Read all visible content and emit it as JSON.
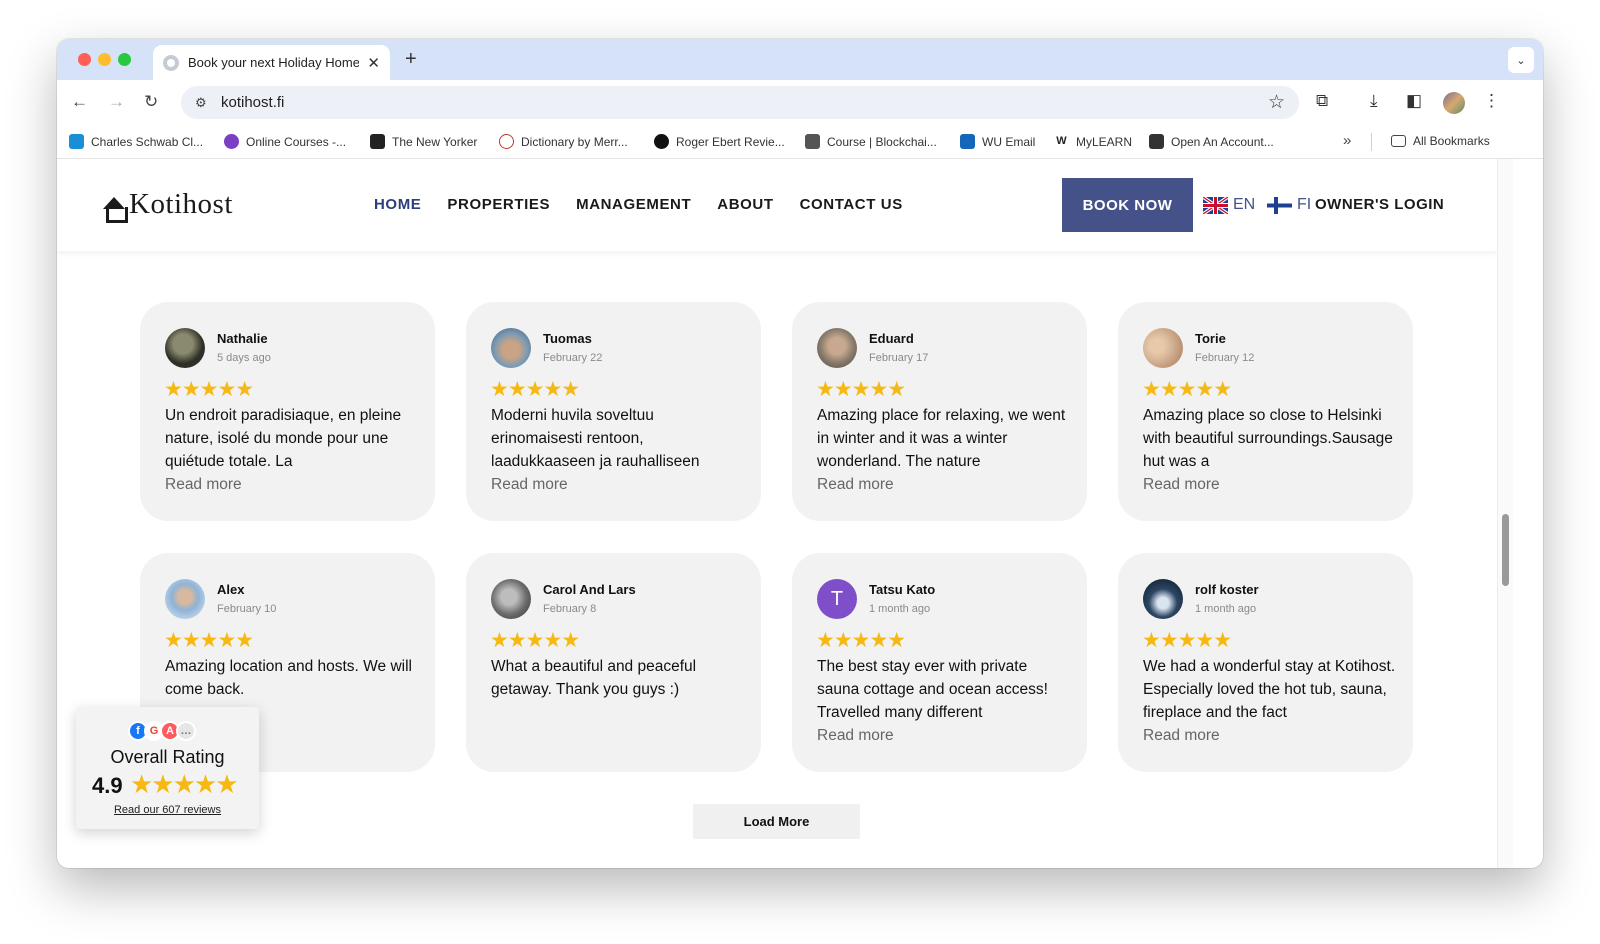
{
  "browser": {
    "tab_title": "Book your next Holiday Home",
    "url": "kotihost.fi",
    "bookmarks": [
      {
        "label": "Charles Schwab Cl...",
        "color": "#1a8fd8"
      },
      {
        "label": "Online Courses -...",
        "color": "#7b3fc4"
      },
      {
        "label": "The New Yorker",
        "color": "#222222"
      },
      {
        "label": "Dictionary by Merr...",
        "color": "#c0392b"
      },
      {
        "label": "Roger Ebert Revie...",
        "color": "#111111"
      },
      {
        "label": "Course | Blockchai...",
        "color": "#333333"
      },
      {
        "label": "WU Email",
        "color": "#1467b8"
      },
      {
        "label": "MyLEARN",
        "color": "#222222"
      },
      {
        "label": "Open An Account...",
        "color": "#333333"
      }
    ],
    "all_bookmarks": "All Bookmarks"
  },
  "site": {
    "logo_text": "Kotihost",
    "nav": [
      "HOME",
      "PROPERTIES",
      "MANAGEMENT",
      "ABOUT",
      "CONTACT US"
    ],
    "book_now": "BOOK NOW",
    "lang_en": "EN",
    "lang_fi": "FI",
    "owners_login": "OWNER'S LOGIN"
  },
  "reviews": [
    {
      "name": "Nathalie",
      "date": "5 days ago",
      "stars": "★★★★★",
      "text": "Un endroit paradisiaque, en pleine nature, isolé du monde pour une quiétude totale. La",
      "more": "Read more",
      "avatar_color": "#3a3a32"
    },
    {
      "name": "Tuomas",
      "date": "February 22",
      "stars": "★★★★★",
      "text": "Moderni huvila soveltuu erinomaisesti rentoon, laadukkaaseen ja rauhalliseen",
      "more": "Read more",
      "avatar_color": "#7d9bb5"
    },
    {
      "name": "Eduard",
      "date": "February 17",
      "stars": "★★★★★",
      "text": "Amazing place for relaxing, we went in winter and it was a winter wonderland. The nature",
      "more": "Read more",
      "avatar_color": "#8b7d6e"
    },
    {
      "name": "Torie",
      "date": "February 12",
      "stars": "★★★★★",
      "text": "Amazing place so close to Helsinki with beautiful surroundings.Sausage hut was a",
      "more": "Read more",
      "avatar_color": "#d8b79a"
    },
    {
      "name": "Alex",
      "date": "February 10",
      "stars": "★★★★★",
      "text": "Amazing location and hosts. We will come back.",
      "more": "",
      "avatar_color": "#8fb3d6"
    },
    {
      "name": "Carol And Lars",
      "date": "February 8",
      "stars": "★★★★★",
      "text": "What a beautiful and peaceful getaway. Thank you guys :)",
      "more": "",
      "avatar_color": "#6e6e6e"
    },
    {
      "name": "Tatsu Kato",
      "date": "1 month ago",
      "stars": "★★★★★",
      "text": "The best stay ever with private sauna cottage and ocean access! Travelled many different",
      "more": "Read more",
      "avatar_color": "#7e4fc9",
      "initial": "T"
    },
    {
      "name": "rolf koster",
      "date": "1 month ago",
      "stars": "★★★★★",
      "text": "We had a wonderful stay at Kotihost. Especially loved the hot tub, sauna, fireplace and the fact",
      "more": "Read more",
      "avatar_color": "#2d4663"
    }
  ],
  "load_more": "Load More",
  "rating_badge": {
    "title": "Overall Rating",
    "score": "4.9",
    "stars": "★★★★★",
    "link": "Read our 607 reviews",
    "platforms": [
      {
        "name": "facebook-icon",
        "color": "#1877f2",
        "glyph": "f"
      },
      {
        "name": "google-icon",
        "color": "#ea4335",
        "glyph": "G"
      },
      {
        "name": "airbnb-icon",
        "color": "#ff5a5f",
        "glyph": "A"
      },
      {
        "name": "more-icon",
        "color": "#cfcfcf",
        "glyph": "…"
      }
    ]
  },
  "colors": {
    "accent": "#45528a",
    "star": "#f6b812",
    "card_bg": "#f2f2f2"
  }
}
